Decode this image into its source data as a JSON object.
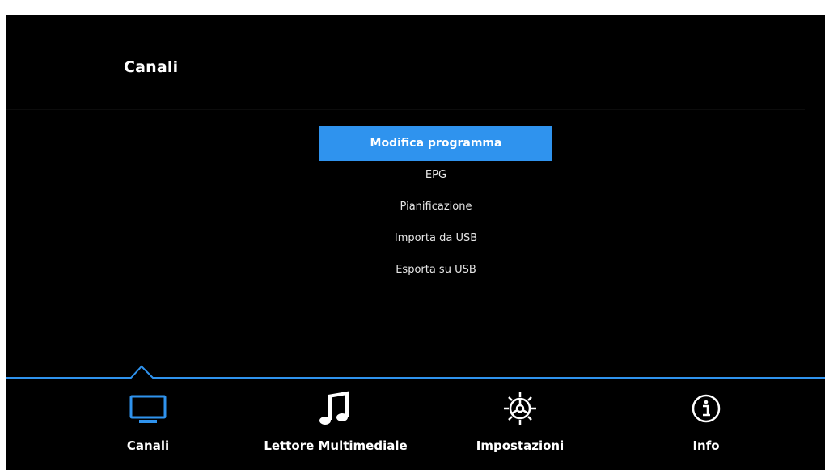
{
  "header": {
    "title": "Canali"
  },
  "menu": {
    "items": [
      {
        "label": "Modifica programma",
        "selected": true
      },
      {
        "label": "EPG",
        "selected": false
      },
      {
        "label": "Pianificazione",
        "selected": false
      },
      {
        "label": "Importa da USB",
        "selected": false
      },
      {
        "label": "Esporta su USB",
        "selected": false
      }
    ]
  },
  "nav": {
    "items": [
      {
        "label": "Canali",
        "icon": "tv-icon",
        "active": true
      },
      {
        "label": "Lettore Multimediale",
        "icon": "music-note-icon",
        "active": false
      },
      {
        "label": "Impostazioni",
        "icon": "gear-icon",
        "active": false
      },
      {
        "label": "Info",
        "icon": "info-icon",
        "active": false
      }
    ]
  },
  "colors": {
    "accent": "#2f93ee",
    "background": "#000000",
    "text": "#ffffff"
  }
}
